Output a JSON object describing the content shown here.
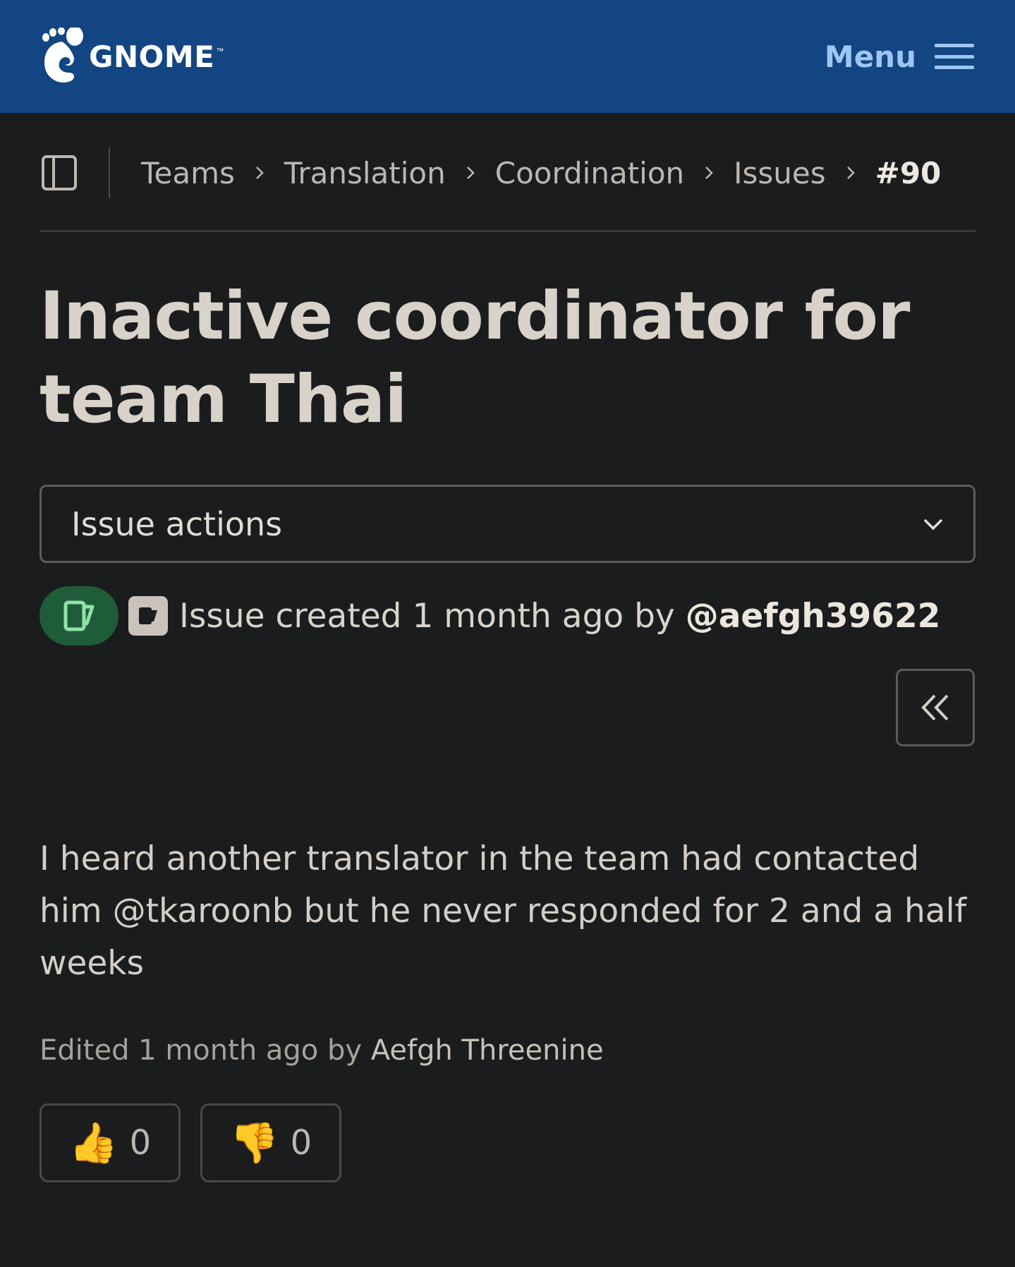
{
  "header": {
    "logo_text": "GNOME",
    "logo_tm": "™",
    "menu_label": "Menu",
    "background_color": "#124582",
    "menu_color": "#9fc6f3"
  },
  "breadcrumb": {
    "items": [
      "Teams",
      "Translation",
      "Coordination",
      "Issues"
    ],
    "current": "#90"
  },
  "issue": {
    "title": "Inactive coordinator for team Thai",
    "actions_label": "Issue actions",
    "status_icon": "issue-open-icon",
    "status_color": "#1e5c3a",
    "created_prefix": "Issue created 1 month ago by ",
    "author": "@aefgh39622",
    "description": "I heard another translator in the team had contacted him @tkaroonb but he never responded for 2 and a half weeks",
    "edited_prefix": "Edited 1 month ago by ",
    "editor": "Aefgh Threenine"
  },
  "reactions": [
    {
      "emoji": "👍",
      "icon": "thumbs-up-icon",
      "count": "0"
    },
    {
      "emoji": "👎",
      "icon": "thumbs-down-icon",
      "count": "0"
    }
  ]
}
